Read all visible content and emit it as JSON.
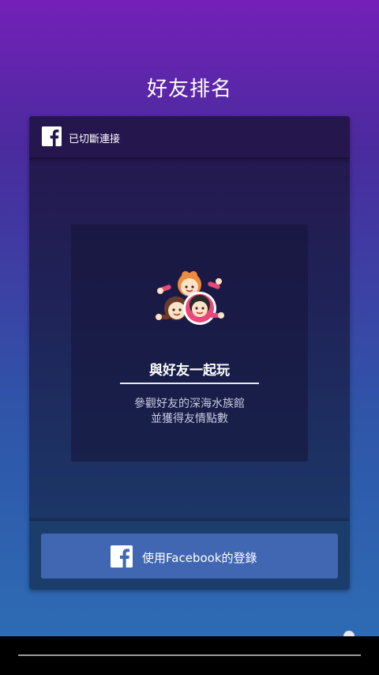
{
  "screen": {
    "title": "好友排名"
  },
  "header": {
    "status_text": "已切斷連接",
    "icon": "facebook-icon"
  },
  "card": {
    "icon": "friends-avatar-icon",
    "title": "與好友一起玩",
    "desc_line1": "參觀好友的深海水族館",
    "desc_line2": "並獲得友情點數"
  },
  "footer": {
    "login_label": "使用Facebook的登錄",
    "icon": "facebook-icon"
  },
  "colors": {
    "facebook_blue": "#4167b2",
    "background_top": "#7420b8",
    "background_bottom": "#2d6fb6"
  }
}
